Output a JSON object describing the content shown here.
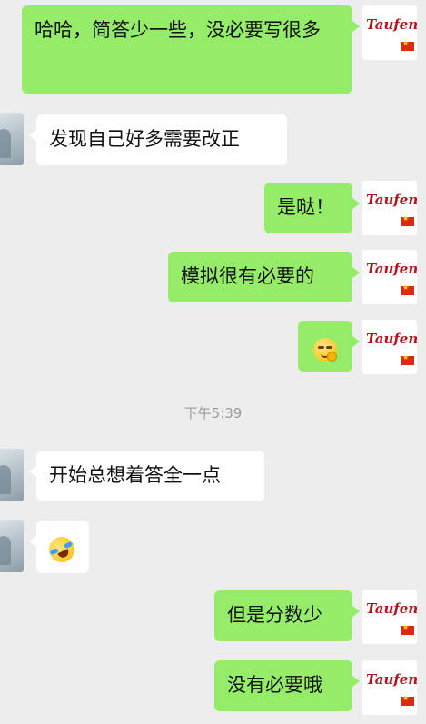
{
  "messages": [
    {
      "side": "out",
      "text": "哈哈，简答少一些，没必要写很多"
    },
    {
      "side": "in",
      "text": "发现自己好多需要改正"
    },
    {
      "side": "out",
      "text": "是哒！"
    },
    {
      "side": "out",
      "text": "模拟很有必要的"
    },
    {
      "side": "out",
      "emoji": "smug-face-emoji"
    },
    {
      "side": "in",
      "text": "开始总想着答全一点"
    },
    {
      "side": "in",
      "emoji": "rolling-laughing-emoji"
    },
    {
      "side": "out",
      "text": "但是分数少"
    },
    {
      "side": "out",
      "text": "没有必要哦"
    }
  ],
  "timestamp": "下午5:39",
  "my_avatar": {
    "brand": "Taufen",
    "flag": "china-flag"
  },
  "colors": {
    "outgoing": "#95ec69",
    "incoming": "#ffffff",
    "background": "#ededed",
    "brand": "#b3141b"
  }
}
